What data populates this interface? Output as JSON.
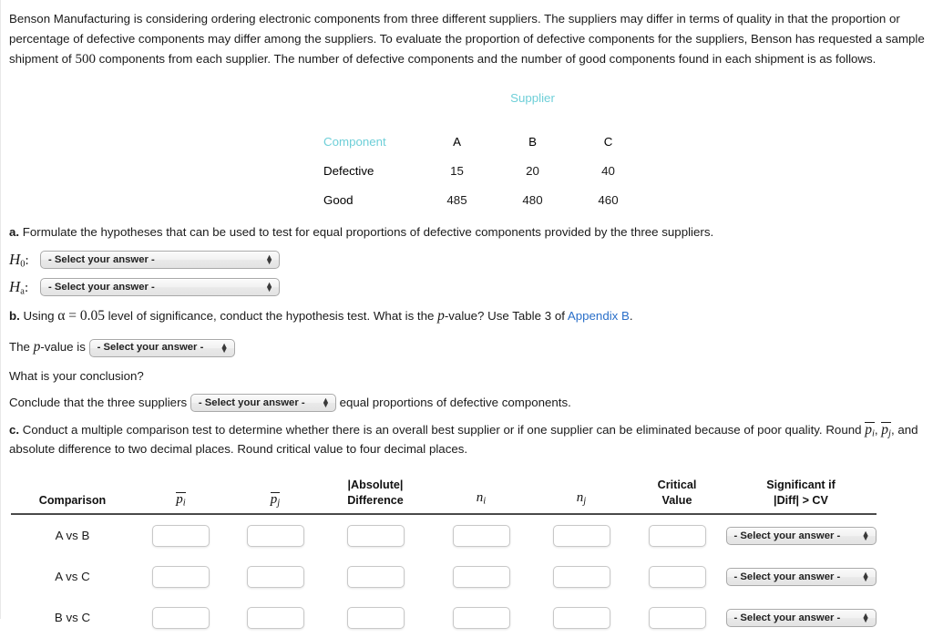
{
  "intro": {
    "part1": "Benson Manufacturing is considering ordering electronic components from three different suppliers. The suppliers may differ in terms of quality in that the proportion or percentage of defective components may differ among the suppliers. To evaluate the proportion of defective components for the suppliers, Benson has requested a sample shipment of ",
    "sample_size": "500",
    "part2": " components from each supplier. The number of defective components and the number of good components found in each shipment is as follows."
  },
  "supplier_table": {
    "title": "Supplier",
    "component_header": "Component",
    "columns": [
      "A",
      "B",
      "C"
    ],
    "rows": [
      {
        "label": "Defective",
        "values": [
          "15",
          "20",
          "40"
        ]
      },
      {
        "label": "Good",
        "values": [
          "485",
          "480",
          "460"
        ]
      }
    ]
  },
  "part_a": {
    "marker": "a.",
    "text": " Formulate the hypotheses that can be used to test for equal proportions of defective components provided by the three suppliers.",
    "h0_label": "H",
    "h0_sub": "0",
    "ha_label": "H",
    "ha_sub": "a",
    "colon": ":",
    "select_placeholder": "- Select your answer -"
  },
  "part_b": {
    "marker": "b.",
    "text_1": " Using ",
    "alpha": "α",
    "equals_value": " = 0.05",
    "text_2": " level of significance, conduct the hypothesis test. What is the ",
    "p_italic": "p",
    "text_3": "-value? Use Table 3 of ",
    "link_text": "Appendix B",
    "text_4": ".",
    "pvalue_prefix": "The ",
    "pvalue_mid": "-value is",
    "select_placeholder": "- Select your answer -",
    "conclusion_question": "What is your conclusion?",
    "conclude_prefix": "Conclude that the three suppliers",
    "conclude_suffix": "equal proportions of defective components."
  },
  "part_c": {
    "marker": "c.",
    "text_1": " Conduct a multiple comparison test to determine whether there is an overall best supplier or if one supplier can be eliminated because of poor quality. Round ",
    "text_2": ", and absolute difference to two decimal places. Round critical value to four decimal places.",
    "p_symbol": "p",
    "sub_i": "i",
    "sub_j": "j",
    "comma": ", "
  },
  "comparison_table": {
    "headers": {
      "comparison": "Comparison",
      "p_i_symbol": "p",
      "p_i_sub": "i",
      "p_j_symbol": "p",
      "p_j_sub": "j",
      "abs_line1": "|Absolute|",
      "abs_line2": "Difference",
      "n_i_symbol": "n",
      "n_i_sub": "i",
      "n_j_symbol": "n",
      "n_j_sub": "j",
      "cv_line1": "Critical",
      "cv_line2": "Value",
      "sig_line1": "Significant if",
      "sig_line2": "|Diff| > CV"
    },
    "rows": [
      {
        "name": "A vs B",
        "p_i": "",
        "p_j": "",
        "abs_diff": "",
        "n_i": "",
        "n_j": "",
        "critical_value": "",
        "significant": "- Select your answer -"
      },
      {
        "name": "A vs C",
        "p_i": "",
        "p_j": "",
        "abs_diff": "",
        "n_i": "",
        "n_j": "",
        "critical_value": "",
        "significant": "- Select your answer -"
      },
      {
        "name": "B vs C",
        "p_i": "",
        "p_j": "",
        "abs_diff": "",
        "n_i": "",
        "n_j": "",
        "critical_value": "",
        "significant": "- Select your answer -"
      }
    ]
  },
  "colors": {
    "accent_teal": "#6ecfd8",
    "link_blue": "#2a6fc9",
    "text": "#1a1a1a"
  },
  "icons": {
    "updown_arrows": "↕"
  }
}
